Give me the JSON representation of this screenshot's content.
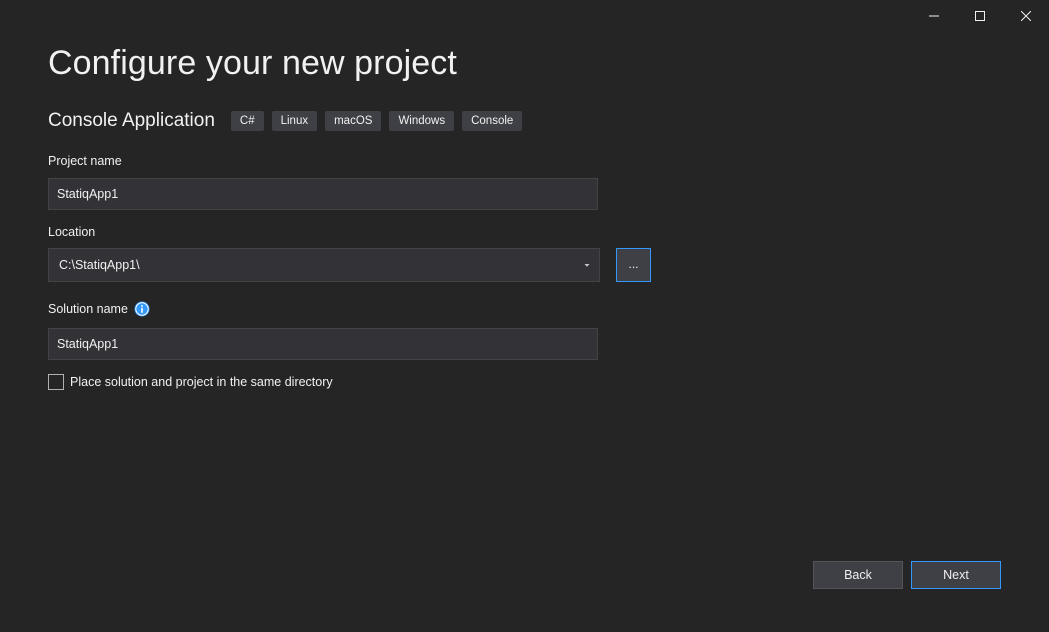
{
  "window_controls": {
    "minimize": "minimize-icon",
    "maximize": "maximize-icon",
    "close": "close-icon"
  },
  "page": {
    "title": "Configure your new project"
  },
  "template": {
    "name": "Console Application",
    "tags": [
      "C#",
      "Linux",
      "macOS",
      "Windows",
      "Console"
    ]
  },
  "project_name": {
    "label": "Project name",
    "value": "StatiqApp1"
  },
  "location": {
    "label": "Location",
    "value": "C:\\StatiqApp1\\",
    "browse_label": "..."
  },
  "solution_name": {
    "label": "Solution name",
    "value": "StatiqApp1",
    "info_icon": "info-icon"
  },
  "same_directory": {
    "label": "Place solution and project in the same directory",
    "checked": false
  },
  "footer": {
    "back_label": "Back",
    "next_label": "Next"
  },
  "colors": {
    "background": "#252526",
    "input_background": "#333337",
    "tag_background": "#3f3f46",
    "accent": "#3399ff",
    "info_icon": "#3399ff"
  }
}
